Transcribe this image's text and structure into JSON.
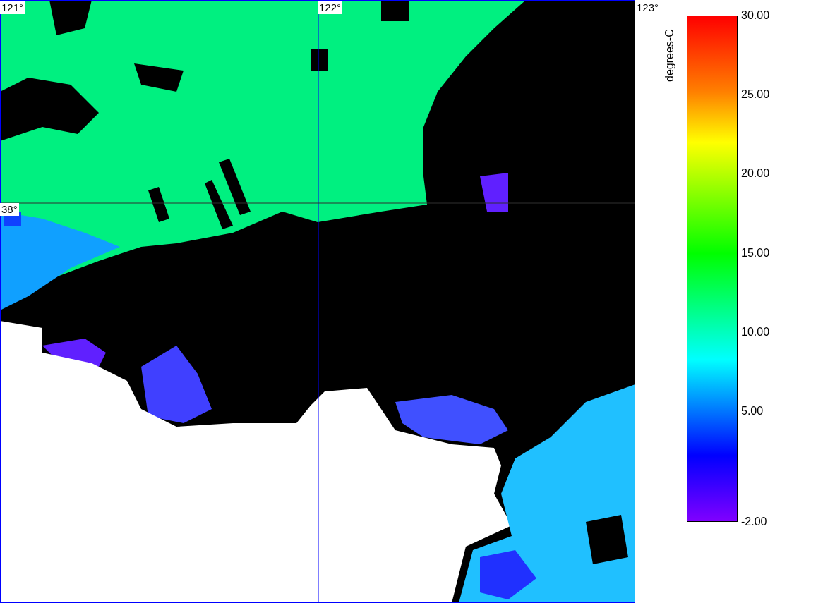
{
  "map": {
    "lon_labels": [
      "121°",
      "122°",
      "123°"
    ],
    "lat_labels": [
      "38°"
    ]
  },
  "colorbar": {
    "title": "degrees-C",
    "ticks": [
      "30.00",
      "25.00",
      "20.00",
      "15.00",
      "10.00",
      "5.00",
      "-2.00"
    ]
  }
}
